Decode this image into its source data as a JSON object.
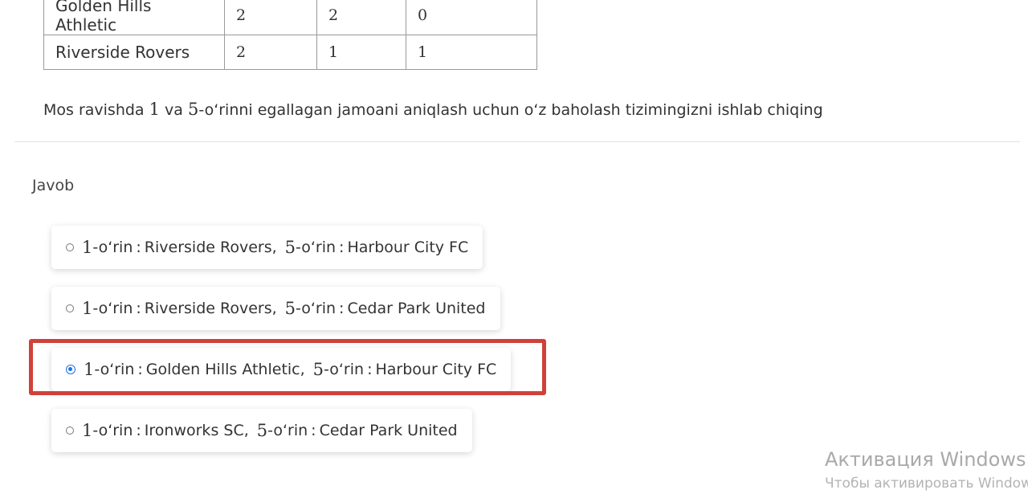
{
  "table": {
    "rows": [
      {
        "team": "Golden Hills Athletic",
        "c1": "2",
        "c2": "2",
        "c3": "0"
      },
      {
        "team": "Riverside Rovers",
        "c1": "2",
        "c2": "1",
        "c3": "1"
      }
    ]
  },
  "question": {
    "pre": "Mos ravishda ",
    "n1": "1",
    "mid": " va ",
    "n2": "5",
    "post": "-o‘rinni egallagan jamoani aniqlash uchun o‘z baholash tizimingizni ishlab chiqing"
  },
  "answer_label": "Javob",
  "options": [
    {
      "first_num": "1",
      "first_suffix": "-o‘rin",
      "first_team": "Riverside Rovers",
      "fifth_num": "5",
      "fifth_suffix": "-o‘rin",
      "fifth_team": "Harbour City FC",
      "selected": false
    },
    {
      "first_num": "1",
      "first_suffix": "-o‘rin",
      "first_team": "Riverside Rovers",
      "fifth_num": "5",
      "fifth_suffix": "-o‘rin",
      "fifth_team": "Cedar Park United",
      "selected": false
    },
    {
      "first_num": "1",
      "first_suffix": "-o‘rin",
      "first_team": "Golden Hills Athletic",
      "fifth_num": "5",
      "fifth_suffix": "-o‘rin",
      "fifth_team": "Harbour City FC",
      "selected": true
    },
    {
      "first_num": "1",
      "first_suffix": "-o‘rin",
      "first_team": "Ironworks SC",
      "fifth_num": "5",
      "fifth_suffix": "-o‘rin",
      "fifth_team": "Cedar Park United",
      "selected": false
    }
  ],
  "colon": ":",
  "comma": ",",
  "colors": {
    "selected_accent": "#1a73e8",
    "highlight_border": "#d0413a"
  },
  "watermark": {
    "title": "Активация Windows",
    "subtitle": "Чтобы активировать Window"
  }
}
